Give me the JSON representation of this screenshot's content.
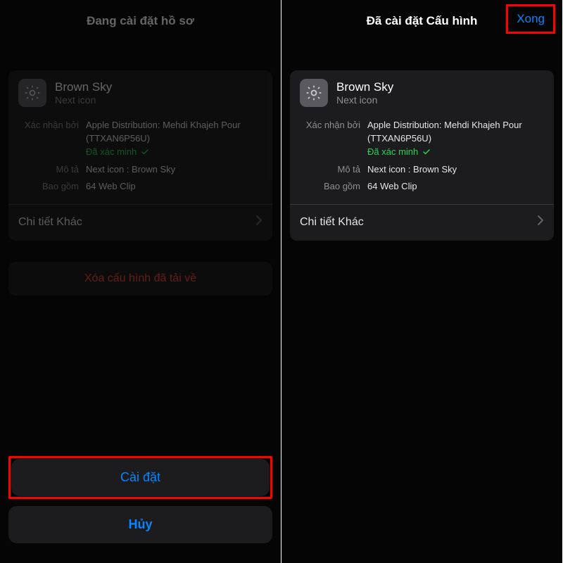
{
  "left": {
    "nav": {
      "title": "Đang cài đặt hồ sơ"
    },
    "profile": {
      "name": "Brown Sky",
      "subtitle": "Next icon",
      "signed_by_label": "Xác nhận bởi",
      "signed_by_value": "Apple Distribution: Mehdi Khajeh Pour (TTXAN6P56U)",
      "verified": "Đã xác minh",
      "desc_label": "Mô tả",
      "desc_value": "Next icon : Brown Sky",
      "contains_label": "Bao gồm",
      "contains_value": "64 Web Clip",
      "more": "Chi tiết Khác"
    },
    "remove": "Xóa cấu hình đã tải về",
    "install": "Cài đặt",
    "cancel": "Hủy"
  },
  "right": {
    "nav": {
      "title": "Đã cài đặt Cấu hình",
      "done": "Xong"
    },
    "profile": {
      "name": "Brown Sky",
      "subtitle": "Next icon",
      "signed_by_label": "Xác nhận bởi",
      "signed_by_value": "Apple Distribution: Mehdi Khajeh Pour (TTXAN6P56U)",
      "verified": "Đã xác minh",
      "desc_label": "Mô tả",
      "desc_value": "Next icon : Brown Sky",
      "contains_label": "Bao gồm",
      "contains_value": "64 Web Clip",
      "more": "Chi tiết Khác"
    }
  }
}
